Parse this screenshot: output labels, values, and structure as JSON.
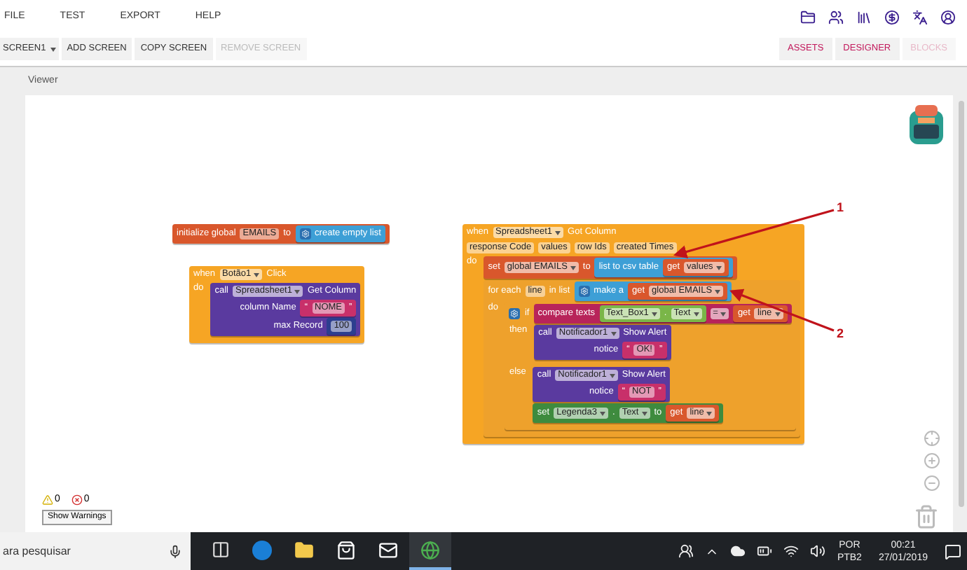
{
  "menu": [
    "FILE",
    "TEST",
    "EXPORT",
    "HELP"
  ],
  "screen_selector": {
    "label": "SCREEN1"
  },
  "screen_buttons": [
    {
      "label": "ADD SCREEN",
      "disabled": false
    },
    {
      "label": "COPY SCREEN",
      "disabled": false
    },
    {
      "label": "REMOVE SCREEN",
      "disabled": true
    }
  ],
  "view_buttons": [
    {
      "label": "ASSETS",
      "disabled": false
    },
    {
      "label": "DESIGNER",
      "disabled": false
    },
    {
      "label": "BLOCKS",
      "disabled": true
    }
  ],
  "viewer": {
    "title": "Viewer"
  },
  "blocks": [
    {
      "color": "#d9572c",
      "rows": [
        [
          {
            "kind": "label",
            "text": "initialize global"
          },
          {
            "kind": "field",
            "text": "EMAILS"
          },
          {
            "kind": "label",
            "text": "to"
          },
          {
            "kind": "input",
            "block": {
              "color": "#3d9fd6",
              "rows": [
                [
                  {
                    "kind": "gear"
                  },
                  {
                    "kind": "label",
                    "text": "create empty list"
                  }
                ]
              ]
            }
          }
        ]
      ]
    },
    {
      "color": "#f6a524",
      "rows": [
        [
          {
            "kind": "label",
            "text": "when"
          },
          {
            "kind": "dropdown",
            "text": "Botão1"
          },
          {
            "kind": "label",
            "text": "Click"
          }
        ],
        [
          {
            "kind": "label",
            "text": "do"
          },
          {
            "kind": "statements",
            "blocks": [
              {
                "color": "#5a3a9f",
                "rows": [
                  [
                    {
                      "kind": "label",
                      "text": "call"
                    },
                    {
                      "kind": "dropdown",
                      "text": "Spreadsheet1"
                    },
                    {
                      "kind": "label",
                      "text": "Get Column"
                    }
                  ]
                ],
                "args": [
                  {
                    "label": "column Name",
                    "block": {
                      "color": "#c8306a",
                      "rows": [
                        [
                          {
                            "kind": "label",
                            "text": "“"
                          },
                          {
                            "kind": "field",
                            "text": "NOME"
                          },
                          {
                            "kind": "label",
                            "text": "”"
                          }
                        ]
                      ]
                    }
                  },
                  {
                    "label": "max Record",
                    "block": {
                      "color": "#2c3e8f",
                      "rows": [
                        [
                          {
                            "kind": "field",
                            "text": "100"
                          }
                        ]
                      ]
                    }
                  }
                ]
              }
            ]
          }
        ]
      ]
    },
    {
      "color": "#f6a524",
      "rows": [
        [
          {
            "kind": "label",
            "text": "when"
          },
          {
            "kind": "dropdown",
            "text": "Spreadsheet1"
          },
          {
            "kind": "label",
            "text": "Got Column"
          }
        ],
        [
          {
            "kind": "field",
            "text": "response Code"
          },
          {
            "kind": "field",
            "text": "values"
          },
          {
            "kind": "field",
            "text": "row Ids"
          },
          {
            "kind": "field",
            "text": "created Times"
          }
        ],
        [
          {
            "kind": "label",
            "text": "do"
          },
          {
            "kind": "statements",
            "blocks": [
              {
                "color": "#d9572c",
                "rows": [
                  [
                    {
                      "kind": "label",
                      "text": "set"
                    },
                    {
                      "kind": "dropdown",
                      "text": "global EMAILS"
                    },
                    {
                      "kind": "label",
                      "text": "to"
                    },
                    {
                      "kind": "input",
                      "block": {
                        "color": "#3d9fd6",
                        "rows": [
                          [
                            {
                              "kind": "label",
                              "text": "list to csv table"
                            },
                            {
                              "kind": "input",
                              "block": {
                                "color": "#d9572c",
                                "rows": [
                                  [
                                    {
                                      "kind": "label",
                                      "text": "get"
                                    },
                                    {
                                      "kind": "dropdown",
                                      "text": "values"
                                    }
                                  ]
                                ]
                              }
                            }
                          ]
                        ]
                      }
                    }
                  ]
                ]
              },
              {
                "color": "#eea12c",
                "rows": [
                  [
                    {
                      "kind": "label",
                      "text": "for each"
                    },
                    {
                      "kind": "field",
                      "text": "line"
                    },
                    {
                      "kind": "label",
                      "text": "in list"
                    },
                    {
                      "kind": "input",
                      "block": {
                        "color": "#3d9fd6",
                        "rows": [
                          [
                            {
                              "kind": "gear"
                            },
                            {
                              "kind": "label",
                              "text": "make a"
                            },
                            {
                              "kind": "input",
                              "block": {
                                "color": "#d9572c",
                                "rows": [
                                  [
                                    {
                                      "kind": "label",
                                      "text": "get"
                                    },
                                    {
                                      "kind": "dropdown",
                                      "text": "global EMAILS"
                                    }
                                  ]
                                ]
                              }
                            }
                          ]
                        ]
                      }
                    }
                  ],
                  [
                    {
                      "kind": "label",
                      "text": "do"
                    },
                    {
                      "kind": "statements",
                      "blocks": [
                        {
                          "color": "#eea12c",
                          "rows": [
                            [
                              {
                                "kind": "gear"
                              },
                              {
                                "kind": "label",
                                "text": "if"
                              },
                              {
                                "kind": "input",
                                "block": {
                                  "color": "#b8245a",
                                  "rows": [
                                    [
                                      {
                                        "kind": "label",
                                        "text": "compare texts"
                                      },
                                      {
                                        "kind": "input",
                                        "block": {
                                          "color": "#7ab648",
                                          "rows": [
                                            [
                                              {
                                                "kind": "dropdown",
                                                "text": "Text_Box1"
                                              },
                                              {
                                                "kind": "label",
                                                "text": "."
                                              },
                                              {
                                                "kind": "dropdown",
                                                "text": "Text"
                                              }
                                            ]
                                          ]
                                        }
                                      },
                                      {
                                        "kind": "dropdown",
                                        "text": "="
                                      },
                                      {
                                        "kind": "input",
                                        "block": {
                                          "color": "#d9572c",
                                          "rows": [
                                            [
                                              {
                                                "kind": "label",
                                                "text": "get"
                                              },
                                              {
                                                "kind": "dropdown",
                                                "text": "line"
                                              }
                                            ]
                                          ]
                                        }
                                      }
                                    ]
                                  ]
                                }
                              }
                            ],
                            [
                              {
                                "kind": "label",
                                "text": "then"
                              },
                              {
                                "kind": "statements",
                                "blocks": [
                                  {
                                    "color": "#5a3a9f",
                                    "rows": [
                                      [
                                        {
                                          "kind": "label",
                                          "text": "call"
                                        },
                                        {
                                          "kind": "dropdown",
                                          "text": "Notificador1"
                                        },
                                        {
                                          "kind": "label",
                                          "text": "Show Alert"
                                        }
                                      ]
                                    ],
                                    "args": [
                                      {
                                        "label": "notice",
                                        "block": {
                                          "color": "#c8306a",
                                          "rows": [
                                            [
                                              {
                                                "kind": "label",
                                                "text": "“"
                                              },
                                              {
                                                "kind": "field",
                                                "text": "OK!"
                                              },
                                              {
                                                "kind": "label",
                                                "text": "”"
                                              }
                                            ]
                                          ]
                                        }
                                      }
                                    ]
                                  }
                                ]
                              }
                            ],
                            [
                              {
                                "kind": "label",
                                "text": "else"
                              },
                              {
                                "kind": "statements",
                                "blocks": [
                                  {
                                    "color": "#5a3a9f",
                                    "rows": [
                                      [
                                        {
                                          "kind": "label",
                                          "text": "call"
                                        },
                                        {
                                          "kind": "dropdown",
                                          "text": "Notificador1"
                                        },
                                        {
                                          "kind": "label",
                                          "text": "Show Alert"
                                        }
                                      ]
                                    ],
                                    "args": [
                                      {
                                        "label": "notice",
                                        "block": {
                                          "color": "#c8306a",
                                          "rows": [
                                            [
                                              {
                                                "kind": "label",
                                                "text": "“"
                                              },
                                              {
                                                "kind": "field",
                                                "text": "NOT"
                                              },
                                              {
                                                "kind": "label",
                                                "text": "”"
                                              }
                                            ]
                                          ]
                                        }
                                      }
                                    ]
                                  },
                                  {
                                    "color": "#3e8b3e",
                                    "rows": [
                                      [
                                        {
                                          "kind": "label",
                                          "text": "set"
                                        },
                                        {
                                          "kind": "dropdown",
                                          "text": "Legenda3"
                                        },
                                        {
                                          "kind": "label",
                                          "text": "."
                                        },
                                        {
                                          "kind": "dropdown",
                                          "text": "Text"
                                        },
                                        {
                                          "kind": "label",
                                          "text": "to"
                                        },
                                        {
                                          "kind": "input",
                                          "block": {
                                            "color": "#d9572c",
                                            "rows": [
                                              [
                                                {
                                                  "kind": "label",
                                                  "text": "get"
                                                },
                                                {
                                                  "kind": "dropdown",
                                                  "text": "line"
                                                }
                                              ]
                                            ]
                                          }
                                        }
                                      ]
                                    ]
                                  }
                                ]
                              }
                            ]
                          ]
                        }
                      ]
                    }
                  ]
                ]
              }
            ]
          }
        ]
      ]
    }
  ],
  "annotations": [
    {
      "label": "1"
    },
    {
      "label": "2"
    }
  ],
  "warnings": {
    "warning_count": "0",
    "error_count": "0",
    "button": "Show Warnings"
  },
  "taskbar": {
    "search": {
      "placeholder": "ara pesquisar"
    },
    "apps": [
      {
        "kind": "task-view",
        "selected": false
      },
      {
        "kind": "browser",
        "selected": false
      },
      {
        "kind": "folder",
        "selected": false
      },
      {
        "kind": "bag",
        "selected": false
      },
      {
        "kind": "envelope",
        "selected": false
      },
      {
        "kind": "globe",
        "selected": true
      }
    ],
    "language": "POR",
    "layout": "PTB2",
    "time": "00:21",
    "date": "27/01/2019"
  }
}
